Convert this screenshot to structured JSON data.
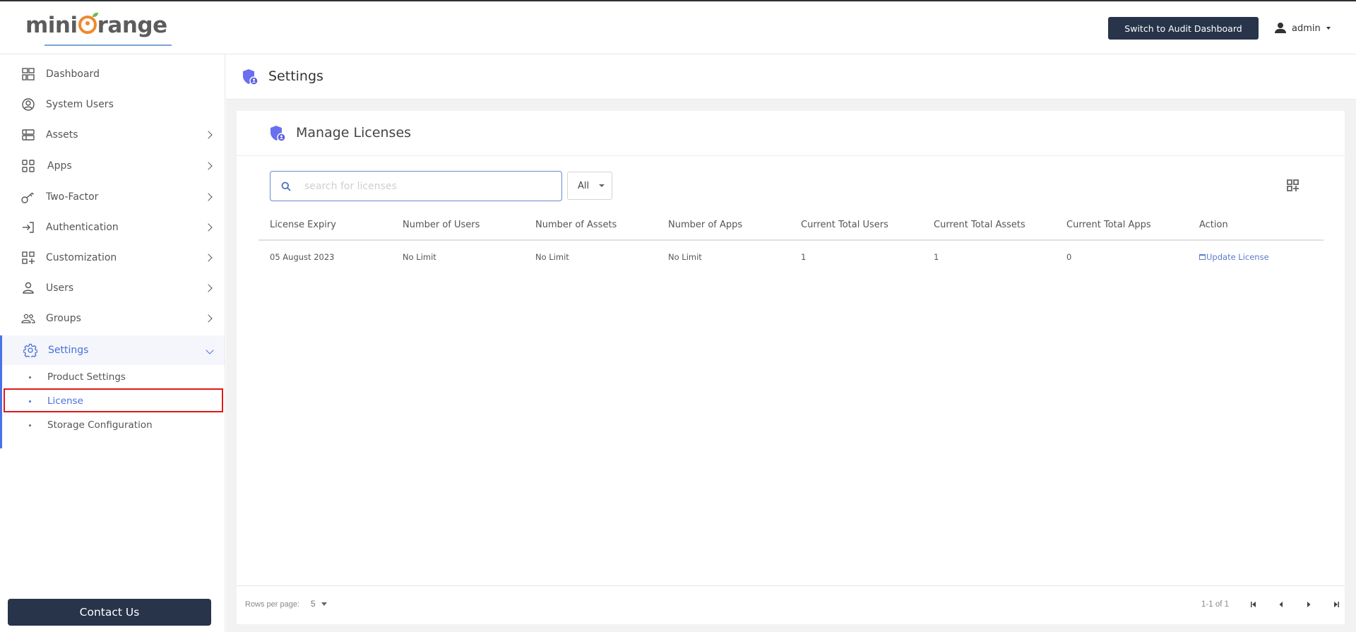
{
  "topbar": {
    "logo_left": "mini",
    "logo_right": "range",
    "audit_button": "Switch to Audit Dashboard",
    "user_name": "admin"
  },
  "sidebar": {
    "items": [
      {
        "label": "Dashboard",
        "icon": "dashboard-icon",
        "has_children": false
      },
      {
        "label": "System Users",
        "icon": "user-circle-icon",
        "has_children": false
      },
      {
        "label": "Assets",
        "icon": "assets-icon",
        "has_children": true
      },
      {
        "label": "Apps",
        "icon": "apps-grid-icon",
        "has_children": true
      },
      {
        "label": "Two-Factor",
        "icon": "key-icon",
        "has_children": true
      },
      {
        "label": "Authentication",
        "icon": "login-icon",
        "has_children": true
      },
      {
        "label": "Customization",
        "icon": "grid-plus-icon",
        "has_children": true
      },
      {
        "label": "Users",
        "icon": "user-icon",
        "has_children": true
      },
      {
        "label": "Groups",
        "icon": "groups-icon",
        "has_children": true
      },
      {
        "label": "Settings",
        "icon": "gear-icon",
        "has_children": true,
        "expanded": true,
        "active": true
      }
    ],
    "settings_children": [
      {
        "label": "Product Settings",
        "active": false
      },
      {
        "label": "License",
        "active": true
      },
      {
        "label": "Storage Configuration",
        "active": false
      }
    ],
    "contact_button": "Contact Us"
  },
  "page": {
    "title": "Settings",
    "card_title": "Manage Licenses"
  },
  "toolbar": {
    "search_placeholder": "search for licenses",
    "search_value": "",
    "filter_selected": "All"
  },
  "table": {
    "columns": [
      "License Expiry",
      "Number of Users",
      "Number of Assets",
      "Number of Apps",
      "Current Total Users",
      "Current Total Assets",
      "Current Total Apps",
      "Action"
    ],
    "rows": [
      {
        "license_expiry": "05 August 2023",
        "number_of_users": "No Limit",
        "number_of_assets": "No Limit",
        "number_of_apps": "No Limit",
        "current_total_users": "1",
        "current_total_assets": "1",
        "current_total_apps": "0",
        "action": "Update License"
      }
    ]
  },
  "pagination": {
    "rows_per_page_label": "Rows per page:",
    "rows_per_page": "5",
    "range": "1-1 of 1"
  },
  "colors": {
    "accent": "#4a6fdc",
    "dark_button": "#27344a",
    "highlight_border": "#e01818",
    "logo_orange": "#f0892c"
  }
}
